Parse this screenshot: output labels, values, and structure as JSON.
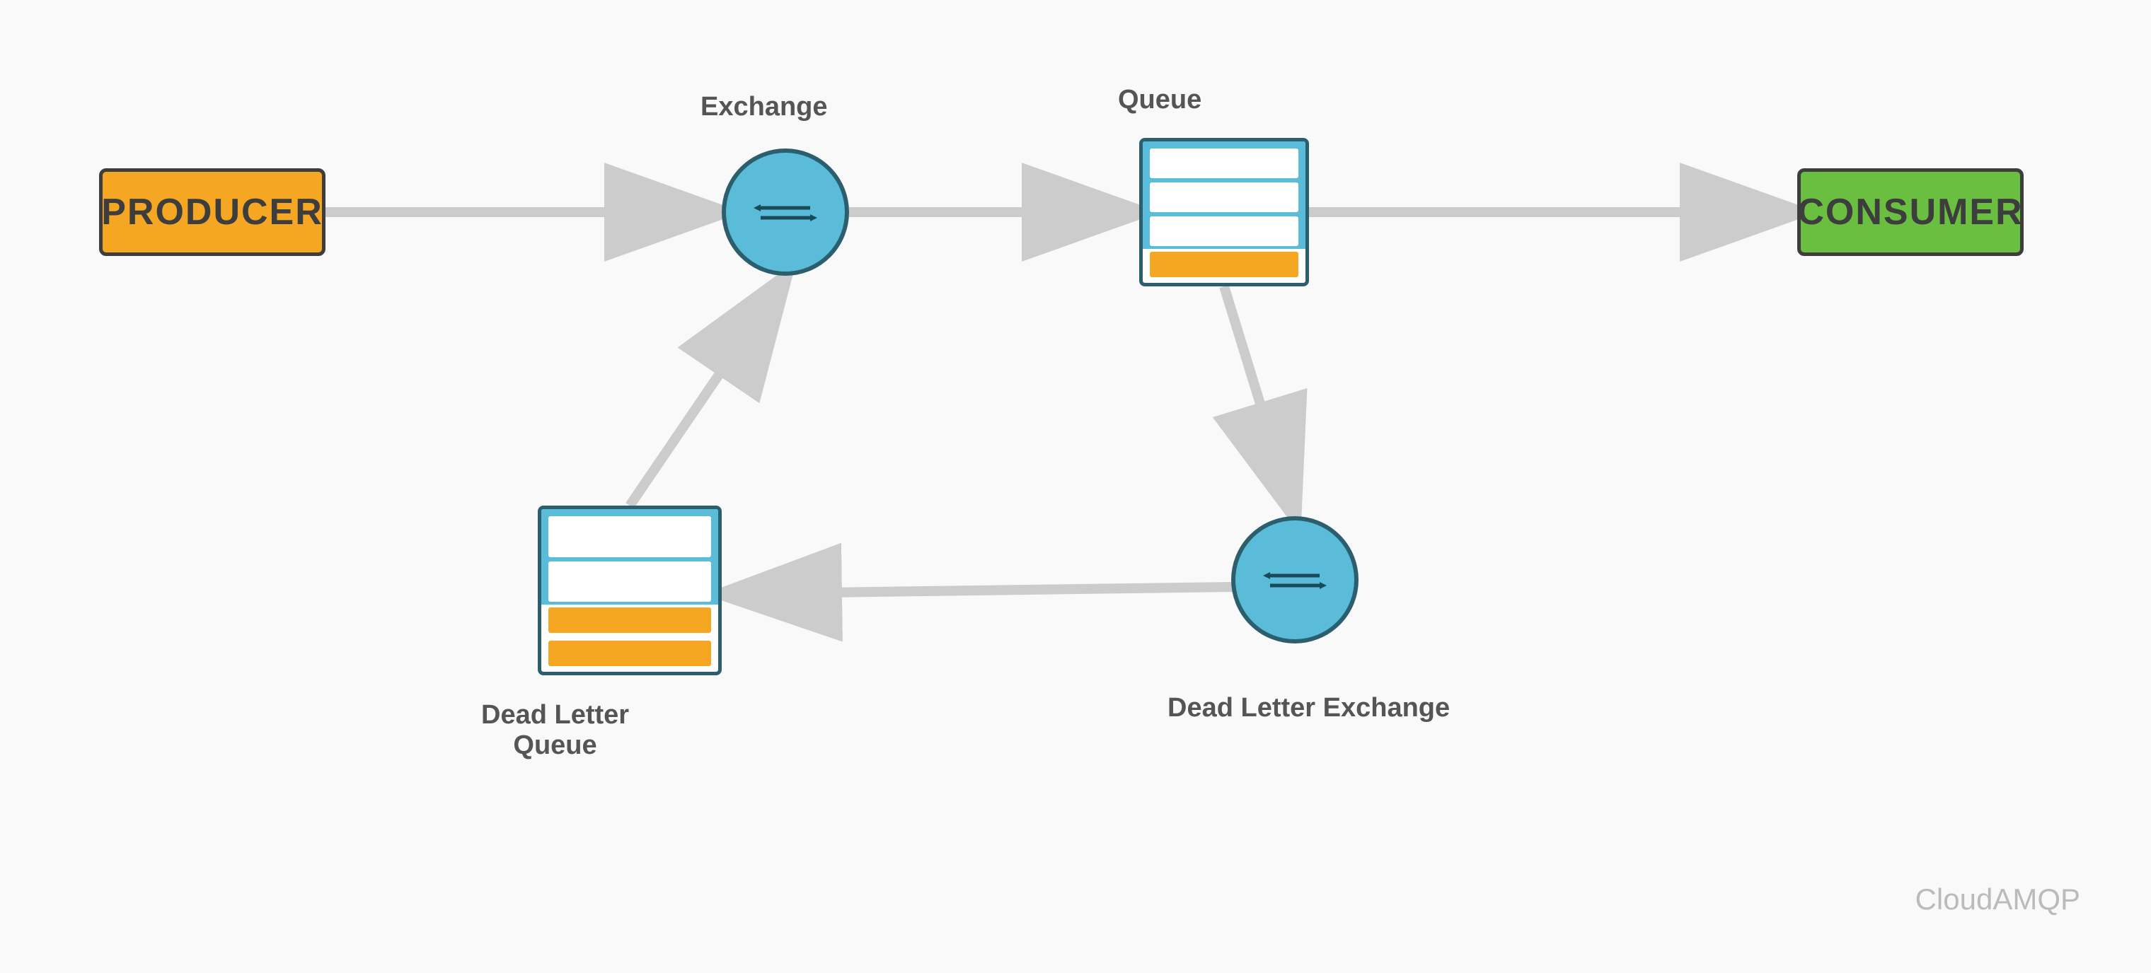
{
  "producer": {
    "label": "PRODUCER",
    "bg": "#F5A623"
  },
  "consumer": {
    "label": "CONSUMER",
    "bg": "#6abf40"
  },
  "exchange_main": {
    "label": "Exchange"
  },
  "exchange_dl": {
    "label": "Dead Letter Exchange"
  },
  "queue_main": {
    "label": "Queue"
  },
  "queue_dl": {
    "label": "Dead Letter\nQueue"
  },
  "watermark": "CloudAMQP",
  "arrows": {
    "producer_to_exchange": "→",
    "exchange_to_queue": "→",
    "queue_to_consumer": "→",
    "queue_to_dl_exchange": "↓",
    "dl_exchange_to_dl_queue": "←",
    "dl_queue_to_exchange": "↑"
  }
}
